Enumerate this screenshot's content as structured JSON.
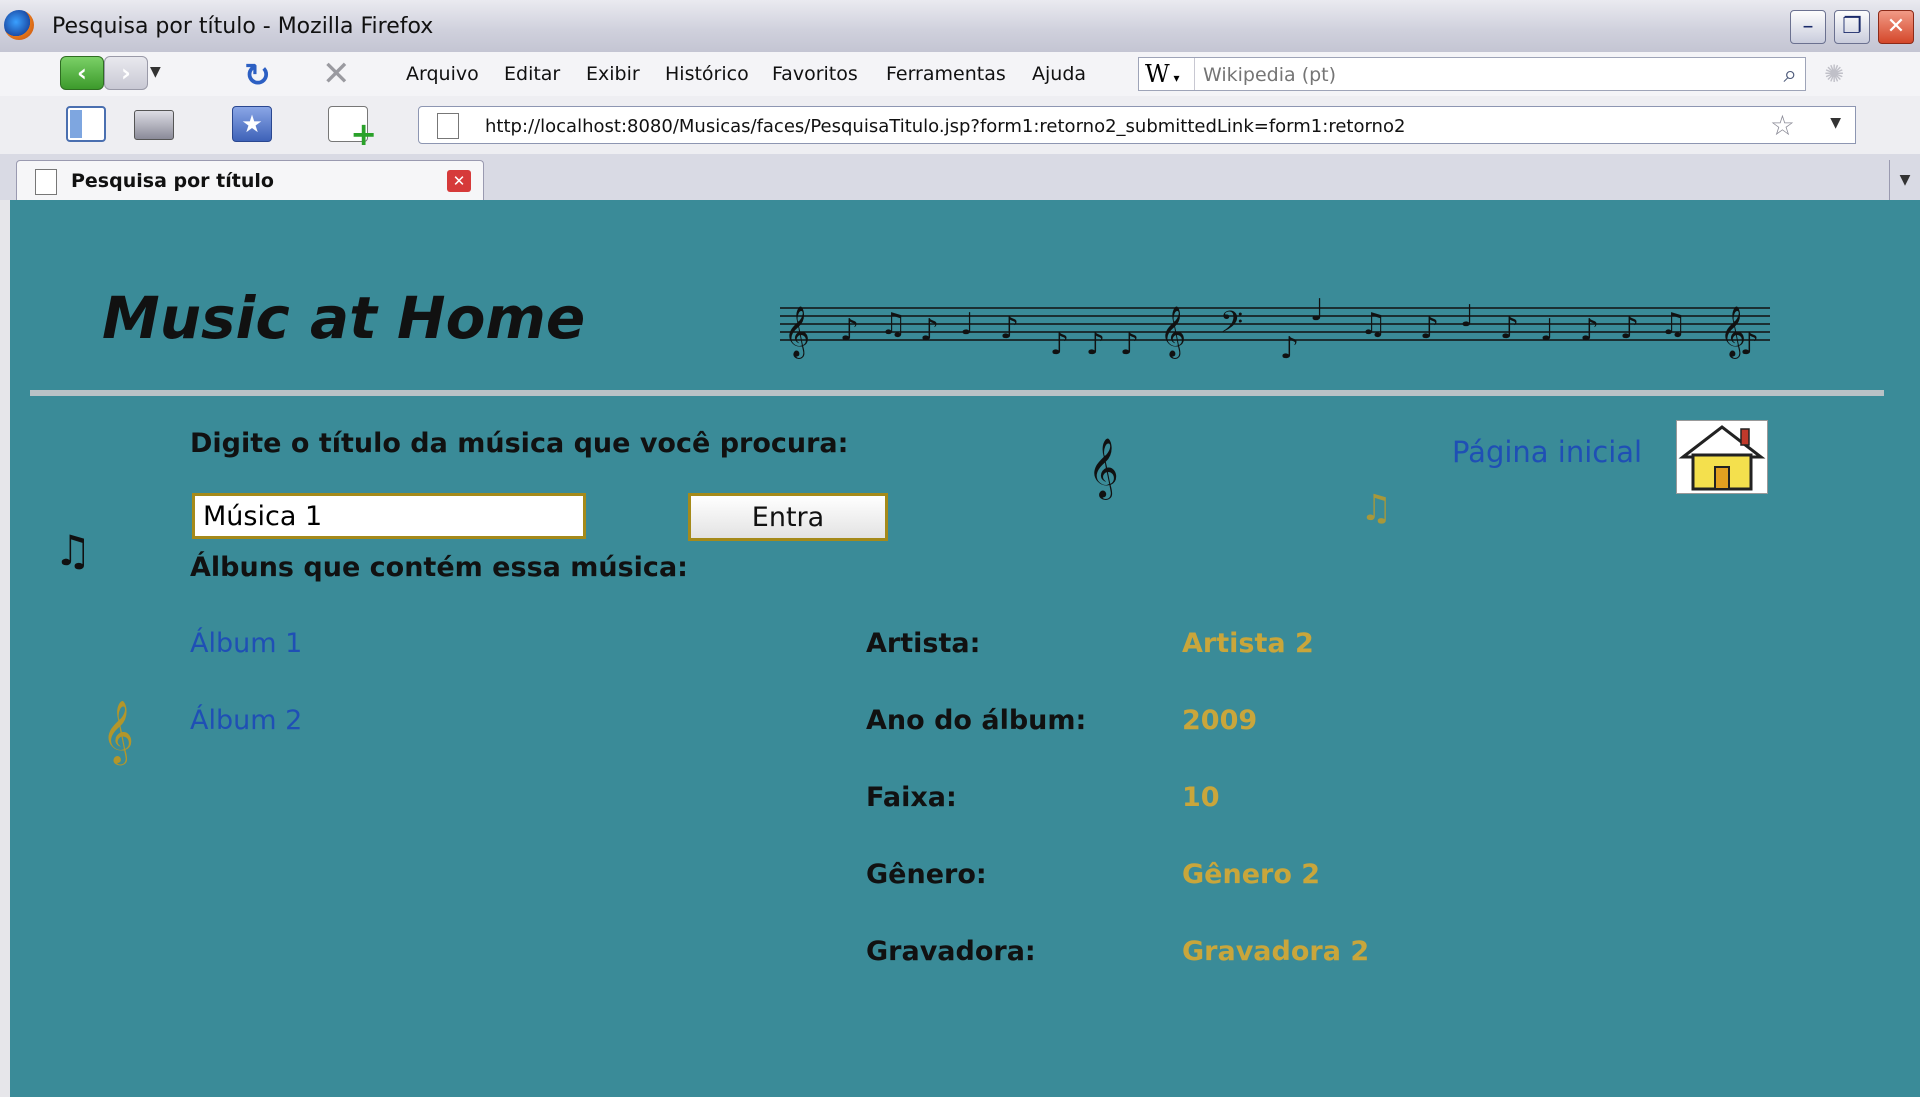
{
  "window": {
    "title": "Pesquisa por título - Mozilla Firefox"
  },
  "menu": [
    "Arquivo",
    "Editar",
    "Exibir",
    "Histórico",
    "Favoritos",
    "Ferramentas",
    "Ajuda"
  ],
  "search": {
    "engine": "W",
    "placeholder": "Wikipedia (pt)"
  },
  "url": "http://localhost:8080/Musicas/faces/PesquisaTitulo.jsp?form1:retorno2_submittedLink=form1:retorno2",
  "tab": {
    "title": "Pesquisa por título"
  },
  "page": {
    "brand": "Music at Home",
    "prompt": "Digite o título da música que você procura:",
    "query": "Música 1",
    "enter_label": "Entra",
    "albums_heading": "Álbuns que contém essa música:",
    "albums": [
      "Álbum 1",
      "Álbum 2"
    ],
    "home_link": "Página inicial",
    "details": [
      {
        "label": "Artista:",
        "value": "Artista 2"
      },
      {
        "label": "Ano do álbum:",
        "value": "2009"
      },
      {
        "label": "Faixa:",
        "value": "10"
      },
      {
        "label": "Gênero:",
        "value": "Gênero 2"
      },
      {
        "label": "Gravadora:",
        "value": "Gravadora 2"
      }
    ]
  },
  "colors": {
    "background": "#3a8b98",
    "link": "#1f4fb5",
    "value": "#c9a63b",
    "input_border": "#a58a1a"
  },
  "icons": [
    "firefox-icon",
    "back-icon",
    "forward-icon",
    "reload-icon",
    "stop-icon",
    "search-icon",
    "sidebar-icon",
    "print-icon",
    "bookmark-icon",
    "new-tab-icon",
    "page-icon",
    "bookmark-star-icon",
    "close-tab-icon",
    "music-staff-icon",
    "treble-clef-icon",
    "house-icon"
  ]
}
